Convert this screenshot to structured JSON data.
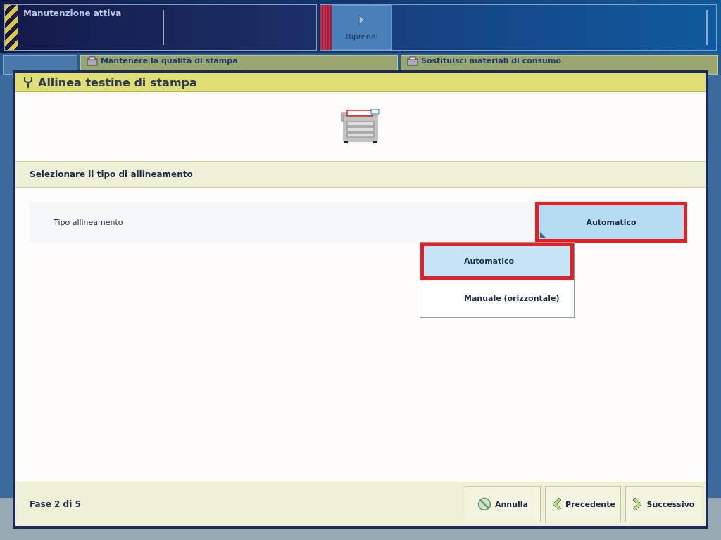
{
  "status_bar": {
    "title": "Manutenzione attiva",
    "resume_button": "Riprendi"
  },
  "background_tabs": [
    {
      "label": "Mantenere la qualità di stampa"
    },
    {
      "label": "Sostituisci materiali di consumo"
    }
  ],
  "dialog": {
    "title": "Allinea testine di stampa",
    "section_title": "Selezionare il tipo di allineamento",
    "setting": {
      "label": "Tipo allineamento",
      "value": "Automatico",
      "highlighted": true,
      "expanded": true
    },
    "options": [
      {
        "label": "Automatico",
        "selected": true,
        "highlighted": true
      },
      {
        "label": "Manuale (orizzontale)",
        "selected": false,
        "highlighted": false
      }
    ],
    "step": "Fase 2 di 5",
    "buttons": [
      {
        "kind": "cancel",
        "label": "Annulla"
      },
      {
        "kind": "back",
        "label": "Precedente"
      },
      {
        "kind": "next",
        "label": "Successivo"
      }
    ]
  }
}
